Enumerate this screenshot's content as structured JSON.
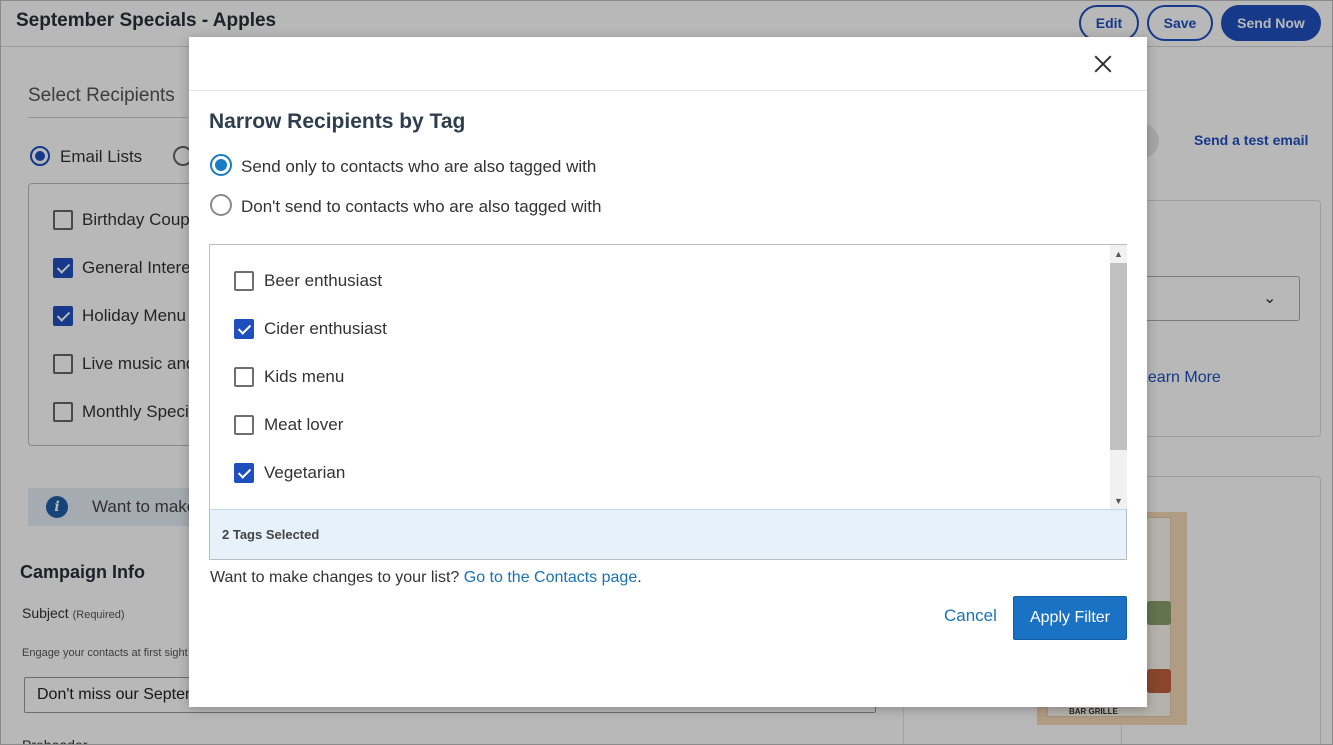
{
  "page": {
    "title": "September Specials - Apples",
    "buttons": {
      "edit": "Edit",
      "save": "Save",
      "send_now": "Send Now"
    }
  },
  "recipients": {
    "heading": "Select Recipients",
    "mode_option": "Email Lists",
    "lists": [
      {
        "label": "Birthday Coupon",
        "checked": false
      },
      {
        "label": "General Interest",
        "checked": true
      },
      {
        "label": "Holiday Menu",
        "checked": true
      },
      {
        "label": "Live music and events",
        "checked": false
      },
      {
        "label": "Monthly Specials",
        "checked": false
      }
    ],
    "info_text": "Want to make changes to your list?"
  },
  "campaign": {
    "heading": "Campaign Info",
    "subject_label": "Subject",
    "subject_required": "(Required)",
    "subject_hint": "Engage your contacts at first sight",
    "subject_value": "Don't miss our September Specials",
    "next_label": "Preheader"
  },
  "right_panel": {
    "test_email": "Send a test email",
    "learn_more": "Learn More",
    "thumb_logo": "BAR GRILLE"
  },
  "modal": {
    "title": "Narrow Recipients by Tag",
    "options": [
      {
        "label": "Send only to contacts who are also tagged with",
        "selected": true
      },
      {
        "label": "Don't send to contacts who are also tagged with",
        "selected": false
      }
    ],
    "tags": [
      {
        "label": "Beer enthusiast",
        "checked": false
      },
      {
        "label": "Cider enthusiast",
        "checked": true
      },
      {
        "label": "Kids menu",
        "checked": false
      },
      {
        "label": "Meat lover",
        "checked": false
      },
      {
        "label": "Vegetarian",
        "checked": true
      }
    ],
    "selected_count": "2 Tags Selected",
    "changes_text": "Want to make changes to your list?",
    "changes_link": "Go to the Contacts page",
    "changes_period": ".",
    "cancel_label": "Cancel",
    "apply_label": "Apply Filter"
  },
  "colors": {
    "primary": "#1f4fbf",
    "modal_accent": "#1a72c4",
    "footer_tint": "#e7f1fa"
  },
  "icons": {
    "close": "close-icon",
    "info": "info-icon",
    "check": "check-icon",
    "chevron": "chevron-down-icon"
  }
}
